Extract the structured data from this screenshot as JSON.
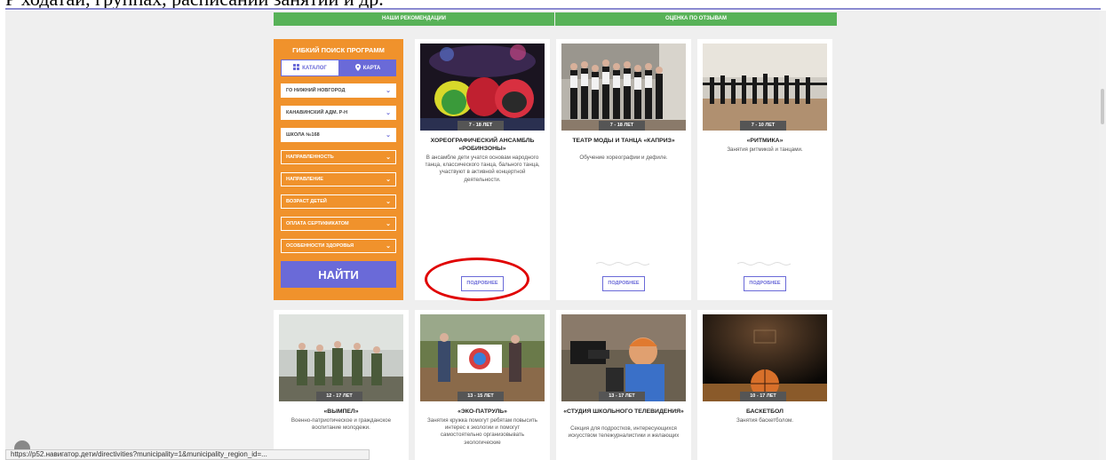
{
  "caption": "Р ходатаи, группах, расписании занятии и др.",
  "headers": {
    "recommend": "НАШИ РЕКОМЕНДАЦИИ",
    "rating": "ОЦЕНКА ПО ОТЗЫВАМ"
  },
  "filter": {
    "title": "ГИБКИЙ ПОИСК ПРОГРАММ",
    "tab_catalog": "КАТАЛОГ",
    "tab_map": "КАРТА",
    "selects": [
      "ГО НИЖНИЙ НОВГОРОД",
      "КАНАВИНСКИЙ АДМ. Р-Н",
      "ШКОЛА №168",
      "НАПРАВЛЕННОСТЬ",
      "НАПРАВЛЕНИЕ",
      "ВОЗРАСТ ДЕТЕЙ",
      "ОПЛАТА СЕРТИФИКАТОМ",
      "ОСОБЕННОСТИ ЗДОРОВЬЯ"
    ],
    "find": "НАЙТИ"
  },
  "cards": [
    {
      "age": "7 - 18 ЛЕТ",
      "title": "ХОРЕОГРАФИЧЕСКИЙ АНСАМБЛЬ «РОБИНЗОНЫ»",
      "desc": "В ансамбле дети учатся основам народного танца, классического танца, бального танца, участвуют в активной концертной деятельности.",
      "more": "ПОДРОБНЕЕ"
    },
    {
      "age": "7 - 18 ЛЕТ",
      "title": "ТЕАТР МОДЫ И ТАНЦА «КАПРИЗ»",
      "desc": "Обучение хореографии и дефиле.",
      "more": "ПОДРОБНЕЕ"
    },
    {
      "age": "7 - 10 ЛЕТ",
      "title": "«РИТМИКА»",
      "desc": "Занятия ритмикой и танцами.",
      "more": "ПОДРОБНЕЕ"
    },
    {
      "age": "12 - 17 ЛЕТ",
      "title": "«ВЫМПЕЛ»",
      "desc": "Военно-патриотическое и гражданское воспитание молодежи."
    },
    {
      "age": "13 - 15 ЛЕТ",
      "title": "«ЭКО-ПАТРУЛЬ»",
      "desc": "Занятия кружка помогут ребятам повысить интерес к экологии и помогут самостоятельно организовывать экологические"
    },
    {
      "age": "13 - 17 ЛЕТ",
      "title": "«СТУДИЯ ШКОЛЬНОГО ТЕЛЕВИДЕНИЯ»",
      "desc": "Секция для подростков, интересующихся искусством тележурналистики и желающих"
    },
    {
      "age": "10 - 17 ЛЕТ",
      "title": "БАСКЕТБОЛ",
      "desc": "Занятия баскетболом."
    }
  ],
  "status_url": "https://p52.навигатор.дети/directivities?municipality=1&municipality_region_id=..."
}
